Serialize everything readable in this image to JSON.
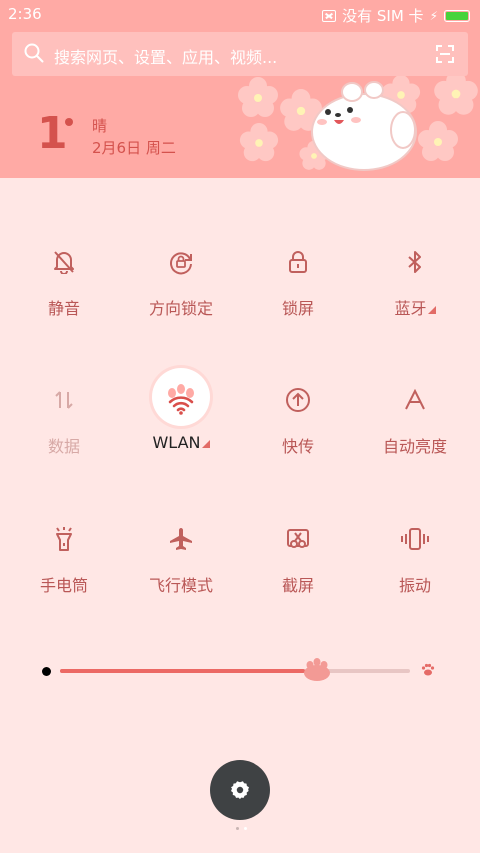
{
  "status_bar": {
    "time": "2:36",
    "carrier": "没有 SIM 卡"
  },
  "search": {
    "placeholder": "搜索网页、设置、应用、视频..."
  },
  "weather": {
    "temperature": "1",
    "condition": "晴",
    "date": "2月6日 周二"
  },
  "toggles": [
    {
      "label": "静音",
      "icon": "bell-off-icon",
      "state": "on"
    },
    {
      "label": "方向锁定",
      "icon": "rotation-lock-icon",
      "state": "on"
    },
    {
      "label": "锁屏",
      "icon": "lock-icon",
      "state": "on"
    },
    {
      "label": "蓝牙",
      "icon": "bluetooth-icon",
      "state": "on",
      "has_submenu": true
    },
    {
      "label": "数据",
      "icon": "data-arrows-icon",
      "state": "disabled"
    },
    {
      "label": "WLAN",
      "icon": "wifi-icon",
      "state": "active",
      "has_submenu": true
    },
    {
      "label": "快传",
      "icon": "upload-circle-icon",
      "state": "on"
    },
    {
      "label": "自动亮度",
      "icon": "auto-brightness-icon",
      "state": "on"
    },
    {
      "label": "手电筒",
      "icon": "flashlight-icon",
      "state": "on"
    },
    {
      "label": "飞行模式",
      "icon": "airplane-icon",
      "state": "on"
    },
    {
      "label": "截屏",
      "icon": "screenshot-icon",
      "state": "on"
    },
    {
      "label": "振动",
      "icon": "vibrate-icon",
      "state": "on"
    }
  ],
  "brightness": {
    "level": 0.7
  },
  "colors": {
    "header": "#ffaaa5",
    "panel": "#ffe7e5",
    "accent": "#ec6964",
    "icon": "#c0605d"
  },
  "page_indicator": {
    "count": 2,
    "active": 1
  }
}
